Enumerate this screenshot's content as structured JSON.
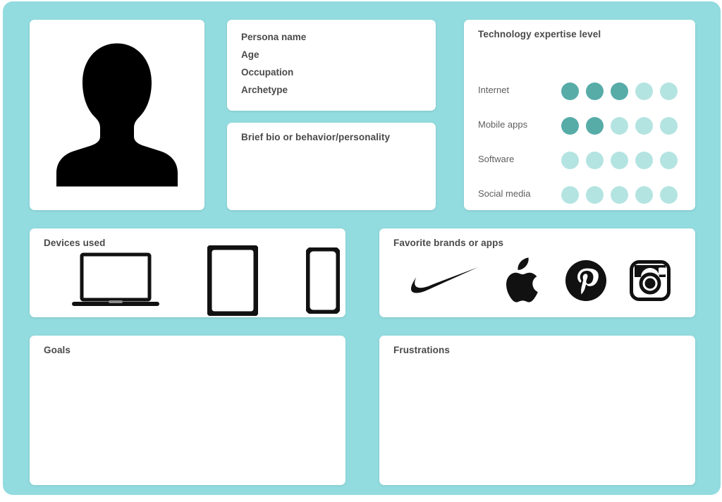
{
  "theme": {
    "background": "#92dbdf",
    "card_background": "#ffffff",
    "dot_filled": "#57aca8",
    "dot_empty": "#b4e4e2",
    "text": "#4a4a4a",
    "icon": "#111111"
  },
  "avatar": {
    "icon": "person-silhouette-icon"
  },
  "persona": {
    "fields": [
      {
        "label": "Persona name"
      },
      {
        "label": "Age"
      },
      {
        "label": "Occupation"
      },
      {
        "label": "Archetype"
      }
    ]
  },
  "bio": {
    "title": "Brief bio or behavior/personality",
    "body": ""
  },
  "expertise": {
    "title": "Technology expertise level",
    "max_level": 5,
    "rows": [
      {
        "label": "Internet",
        "level": 3
      },
      {
        "label": "Mobile apps",
        "level": 2
      },
      {
        "label": "Software",
        "level": 0
      },
      {
        "label": "Social media",
        "level": 0
      }
    ]
  },
  "devices": {
    "title": "Devices used",
    "items": [
      {
        "name": "laptop",
        "icon": "laptop-icon"
      },
      {
        "name": "tablet",
        "icon": "tablet-icon"
      },
      {
        "name": "smartphone",
        "icon": "smartphone-icon"
      }
    ]
  },
  "brands": {
    "title": "Favorite brands or apps",
    "items": [
      {
        "name": "Nike",
        "icon": "nike-swoosh-icon"
      },
      {
        "name": "Apple",
        "icon": "apple-logo-icon"
      },
      {
        "name": "Pinterest",
        "icon": "pinterest-logo-icon"
      },
      {
        "name": "Instagram",
        "icon": "instagram-logo-icon"
      }
    ]
  },
  "goals": {
    "title": "Goals",
    "body": ""
  },
  "frustrations": {
    "title": "Frustrations",
    "body": ""
  }
}
